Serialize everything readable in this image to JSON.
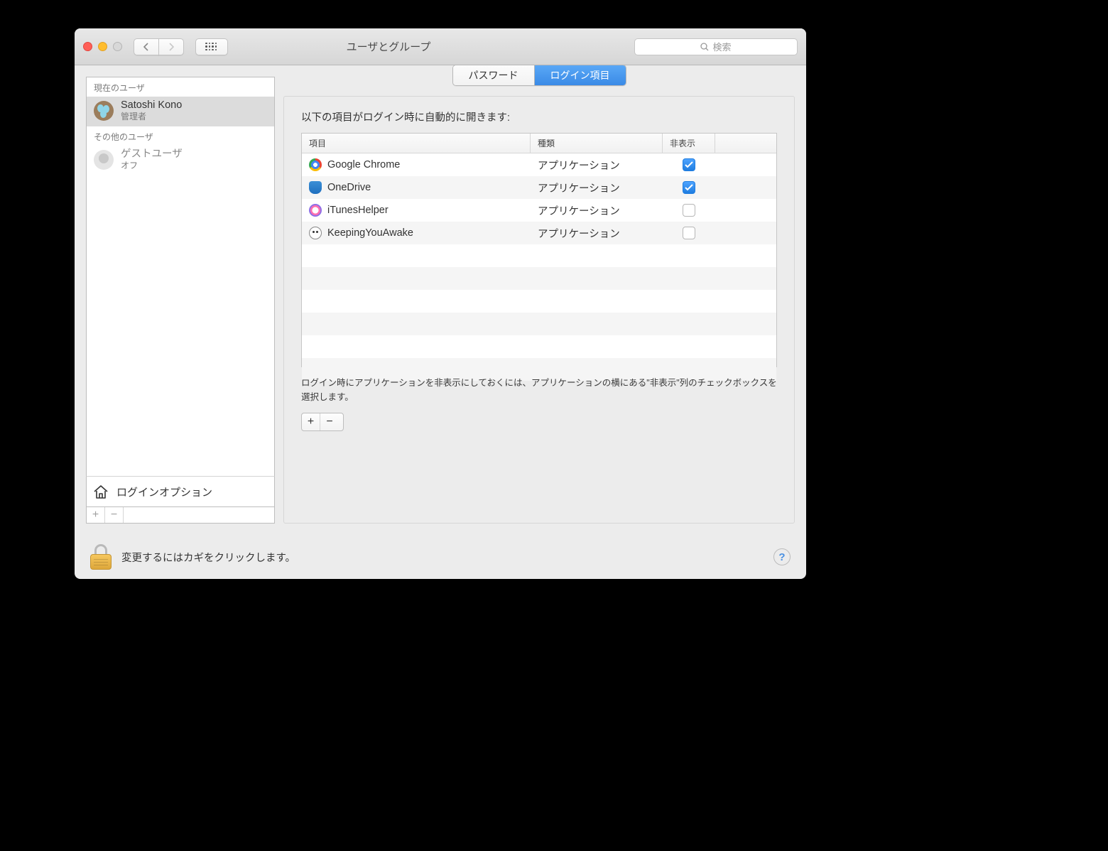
{
  "window": {
    "title": "ユーザとグループ",
    "search_placeholder": "検索"
  },
  "sidebar": {
    "current_user_header": "現在のユーザ",
    "other_users_header": "その他のユーザ",
    "current_user": {
      "name": "Satoshi Kono",
      "role": "管理者"
    },
    "guest_user": {
      "name": "ゲストユーザ",
      "status": "オフ"
    },
    "login_options_label": "ログインオプション"
  },
  "tabs": {
    "password": "パスワード",
    "login_items": "ログイン項目"
  },
  "main": {
    "description": "以下の項目がログイン時に自動的に開きます:",
    "columns": {
      "item": "項目",
      "kind": "種類",
      "hide": "非表示"
    },
    "kind_app": "アプリケーション",
    "items": [
      {
        "name": "Google Chrome",
        "hidden": true,
        "icon": "chrome"
      },
      {
        "name": "OneDrive",
        "hidden": true,
        "icon": "onedrive"
      },
      {
        "name": "iTunesHelper",
        "hidden": false,
        "icon": "itunes"
      },
      {
        "name": "KeepingYouAwake",
        "hidden": false,
        "icon": "awake"
      }
    ],
    "hint": "ログイン時にアプリケーションを非表示にしておくには、アプリケーションの横にある\"非表示\"列のチェックボックスを選択します。"
  },
  "footer": {
    "lock_text": "変更するにはカギをクリックします。"
  }
}
